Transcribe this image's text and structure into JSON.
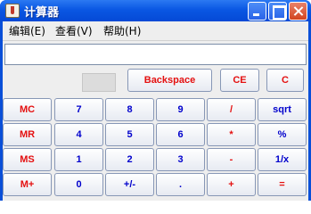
{
  "window": {
    "title": "计算器"
  },
  "menu": [
    {
      "label": "编辑(E)"
    },
    {
      "label": "查看(V)"
    },
    {
      "label": "帮助(H)"
    }
  ],
  "display": {
    "value": ""
  },
  "top_buttons": [
    {
      "label": "Backspace",
      "color": "#e41010"
    },
    {
      "label": "CE",
      "color": "#e41010"
    },
    {
      "label": "C",
      "color": "#e41010"
    }
  ],
  "keypad": [
    [
      {
        "label": "MC",
        "color": "#e41010"
      },
      {
        "label": "7",
        "color": "#0000cc"
      },
      {
        "label": "8",
        "color": "#0000cc"
      },
      {
        "label": "9",
        "color": "#0000cc"
      },
      {
        "label": "/",
        "color": "#e41010"
      },
      {
        "label": "sqrt",
        "color": "#0000cc"
      }
    ],
    [
      {
        "label": "MR",
        "color": "#e41010"
      },
      {
        "label": "4",
        "color": "#0000cc"
      },
      {
        "label": "5",
        "color": "#0000cc"
      },
      {
        "label": "6",
        "color": "#0000cc"
      },
      {
        "label": "*",
        "color": "#e41010"
      },
      {
        "label": "%",
        "color": "#0000cc"
      }
    ],
    [
      {
        "label": "MS",
        "color": "#e41010"
      },
      {
        "label": "1",
        "color": "#0000cc"
      },
      {
        "label": "2",
        "color": "#0000cc"
      },
      {
        "label": "3",
        "color": "#0000cc"
      },
      {
        "label": "-",
        "color": "#e41010"
      },
      {
        "label": "1/x",
        "color": "#0000cc"
      }
    ],
    [
      {
        "label": "M+",
        "color": "#e41010"
      },
      {
        "label": "0",
        "color": "#0000cc"
      },
      {
        "label": "+/-",
        "color": "#0000cc"
      },
      {
        "label": ".",
        "color": "#0000cc"
      },
      {
        "label": "+",
        "color": "#e41010"
      },
      {
        "label": "=",
        "color": "#e41010"
      }
    ]
  ]
}
